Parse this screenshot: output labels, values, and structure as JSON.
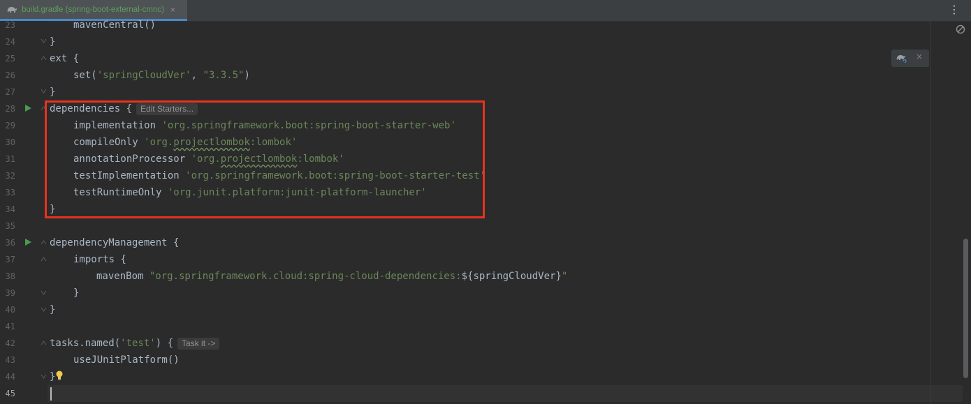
{
  "tab": {
    "title": "build.gradle (spring-boot-external-cmnc)",
    "close": "×",
    "icon": "gradle-elephant-icon"
  },
  "menu_dots": "⋮",
  "line_numbers": [
    "23",
    "24",
    "25",
    "26",
    "27",
    "28",
    "29",
    "30",
    "31",
    "32",
    "33",
    "34",
    "35",
    "36",
    "37",
    "38",
    "39",
    "40",
    "41",
    "42",
    "43",
    "44",
    "45"
  ],
  "code": {
    "l23": "mavenCentral()",
    "l24": "}",
    "l25": "ext {",
    "l26_a": "set(",
    "l26_b": "'springCloudVer'",
    "l26_c": ", ",
    "l26_d": "\"3.3.5\"",
    "l26_e": ")",
    "l27": "}",
    "l28": "dependencies {",
    "l28_hint": "Edit Starters...",
    "l29_a": "implementation ",
    "l29_b": "'org.springframework.boot:spring-boot-starter-web'",
    "l30_a": "compileOnly ",
    "l30_b": "'org.",
    "l30_c": "projectlombok",
    "l30_d": ":lombok'",
    "l31_a": "annotationProcessor ",
    "l31_b": "'org.",
    "l31_c": "projectlombok",
    "l31_d": ":lombok'",
    "l32_a": "testImplementation ",
    "l32_b": "'org.springframework.boot:spring-boot-starter-test'",
    "l33_a": "testRuntimeOnly ",
    "l33_b": "'org.junit.platform:junit-platform-launcher'",
    "l34": "}",
    "l36": "dependencyManagement {",
    "l37": "imports {",
    "l38_a": "mavenBom ",
    "l38_b": "\"org.springframework.cloud:spring-cloud-dependencies:",
    "l38_c": "${springCloudVer}",
    "l38_d": "\"",
    "l39": "}",
    "l40": "}",
    "l42_a": "tasks.named(",
    "l42_b": "'test'",
    "l42_c": ") {",
    "l42_hint": "Task it ->",
    "l43": "useJUnitPlatform()",
    "l44": "}"
  },
  "gradle_popup": {
    "icon": "gradle-reload-icon",
    "close": "×"
  },
  "colors": {
    "background": "#2b2b2b",
    "text": "#a9b7c6",
    "string": "#6a8759",
    "line_number": "#606366",
    "highlight_box": "#e8331f",
    "tab_accent": "#4a88c7"
  }
}
